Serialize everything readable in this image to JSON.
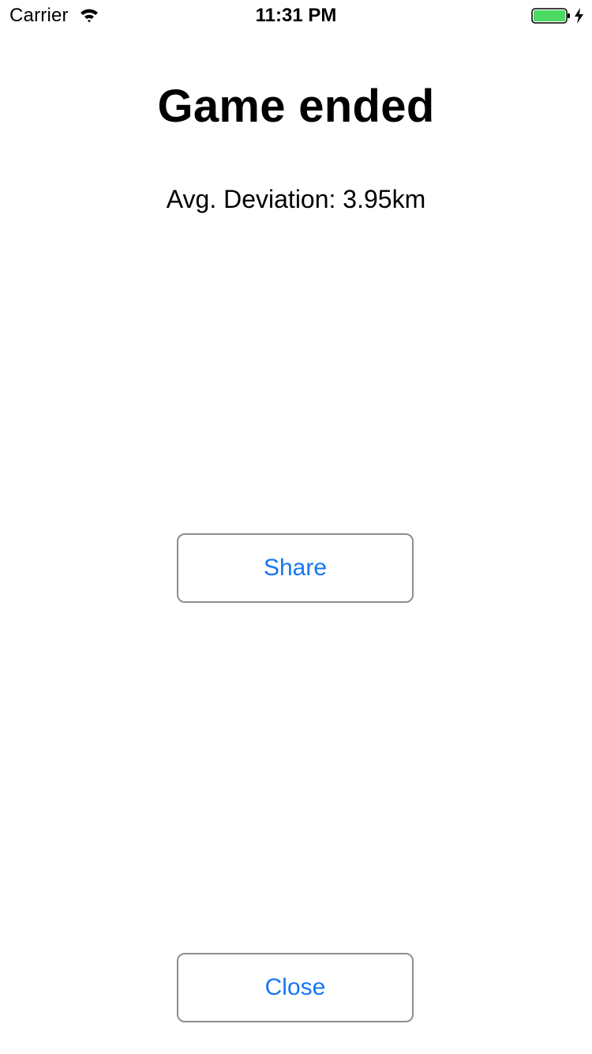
{
  "status_bar": {
    "carrier": "Carrier",
    "time": "11:31 PM",
    "battery_color": "#4cd964"
  },
  "main": {
    "title": "Game ended",
    "avg_deviation": "Avg. Deviation: 3.95km"
  },
  "buttons": {
    "share_label": "Share",
    "close_label": "Close",
    "label_color": "#1677f2",
    "border_color": "#8e8e93"
  },
  "icons": {
    "wifi": "wifi-icon",
    "battery": "battery-icon",
    "charging": "charging-bolt-icon"
  }
}
